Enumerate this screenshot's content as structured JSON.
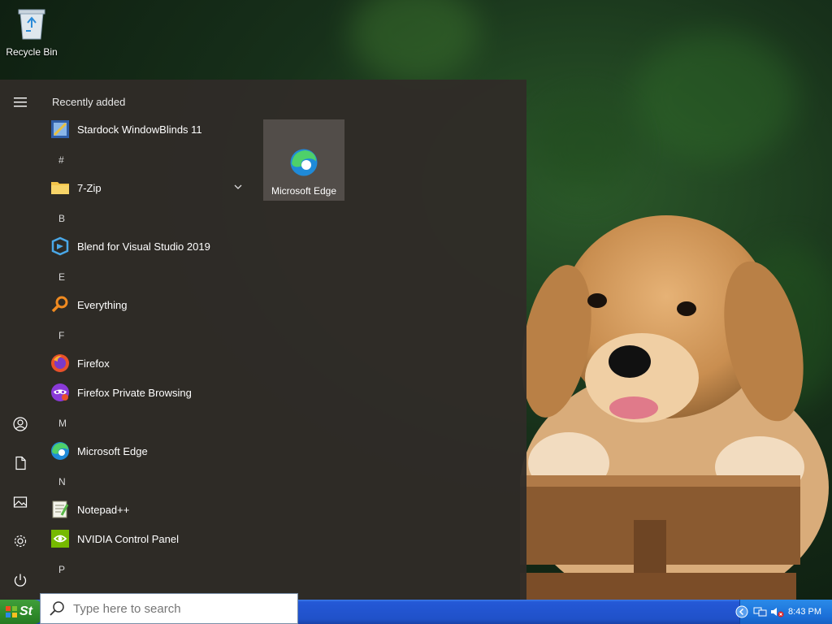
{
  "desktop": {
    "recycle_bin_label": "Recycle Bin"
  },
  "start_menu": {
    "recently_added_title": "Recently added",
    "groups": [
      {
        "letter": "",
        "apps": [
          {
            "label": "Stardock WindowBlinds 11",
            "icon": "windowblinds-icon"
          }
        ]
      },
      {
        "letter": "#",
        "apps": [
          {
            "label": "7-Zip",
            "icon": "folder-icon",
            "expandable": true
          }
        ]
      },
      {
        "letter": "B",
        "apps": [
          {
            "label": "Blend for Visual Studio 2019",
            "icon": "blend-icon"
          }
        ]
      },
      {
        "letter": "E",
        "apps": [
          {
            "label": "Everything",
            "icon": "magnifier-icon"
          }
        ]
      },
      {
        "letter": "F",
        "apps": [
          {
            "label": "Firefox",
            "icon": "firefox-icon"
          },
          {
            "label": "Firefox Private Browsing",
            "icon": "firefox-private-icon"
          }
        ]
      },
      {
        "letter": "M",
        "apps": [
          {
            "label": "Microsoft Edge",
            "icon": "edge-icon"
          }
        ]
      },
      {
        "letter": "N",
        "apps": [
          {
            "label": "Notepad++",
            "icon": "notepadpp-icon"
          },
          {
            "label": "NVIDIA Control Panel",
            "icon": "nvidia-icon"
          }
        ]
      },
      {
        "letter": "P",
        "apps": []
      }
    ],
    "tiles": [
      {
        "label": "Microsoft Edge",
        "icon": "edge-icon"
      }
    ],
    "rail_icons": [
      "hamburger-icon",
      "user-icon",
      "documents-icon",
      "pictures-icon",
      "settings-icon",
      "power-icon"
    ]
  },
  "taskbar": {
    "start_label": "St",
    "search_placeholder": "Type here to search",
    "clock": "8:43 PM"
  },
  "colors": {
    "taskbar_blue": "#2458d6",
    "start_green": "#2f8a2a",
    "menu_bg": "#302c28"
  }
}
